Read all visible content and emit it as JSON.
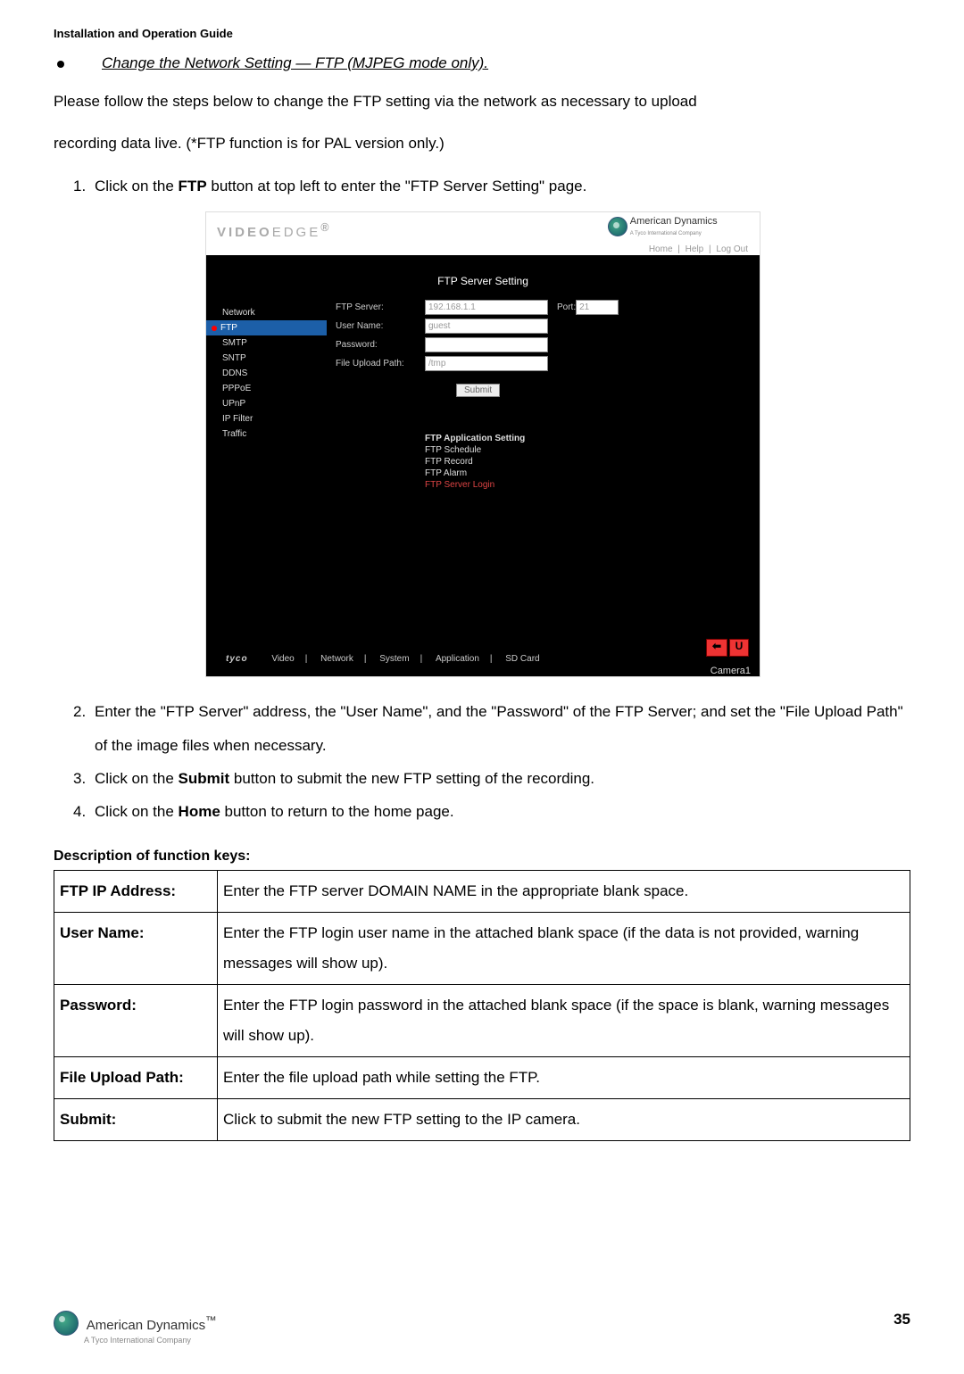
{
  "header": "Installation and Operation Guide",
  "bullet_title": "Change the Network Setting — FTP (MJPEG mode only).",
  "intro1": "Please follow the steps below to change the FTP setting via the network as necessary to upload",
  "intro2": "recording data live. (*FTP function is for PAL version only.)",
  "steps_top": {
    "1": {
      "pre": "1.",
      "a": "Click on the ",
      "b": "FTP",
      "c": " button at top left to enter the \"FTP Server Setting\" page."
    }
  },
  "screenshot": {
    "logo_a": "VIDEO",
    "logo_b": "EDGE",
    "brand": "American Dynamics",
    "brand_sub": "A Tyco International Company",
    "top_links": {
      "home": "Home",
      "help": "Help",
      "logout": "Log Out"
    },
    "panel_title": "FTP Server Setting",
    "menu": [
      "Network",
      "FTP",
      "SMTP",
      "SNTP",
      "DDNS",
      "PPPoE",
      "UPnP",
      "IP Filter",
      "Traffic"
    ],
    "menu_active_index": 1,
    "form": {
      "server_label": "FTP Server:",
      "server_value": "192.168.1.1",
      "port_label": "Port:",
      "port_value": "21",
      "user_label": "User Name:",
      "user_value": "guest",
      "pass_label": "Password:",
      "pass_value": "",
      "path_label": "File Upload Path:",
      "path_value": "/tmp",
      "submit": "Submit"
    },
    "app_links": {
      "title": "FTP Application Setting",
      "items": [
        "FTP Schedule",
        "FTP Record",
        "FTP Alarm",
        "FTP Server Login"
      ],
      "active_index": 3
    },
    "bottom": {
      "tyco": "tyco",
      "links": [
        "Video",
        "Network",
        "System",
        "Application",
        "SD Card"
      ],
      "back": "⬅",
      "u": "U",
      "camera": "Camera1"
    }
  },
  "steps_bottom": {
    "2": "Enter the \"FTP Server\" address, the \"User Name\", and the \"Password\" of the FTP Server; and set the \"File Upload Path\" of the image files when necessary.",
    "3": {
      "a": "Click on the ",
      "b": "Submit",
      "c": " button to submit the new FTP setting of the recording."
    },
    "4": {
      "a": "Click on the ",
      "b": "Home",
      "c": " button to return to the home page."
    }
  },
  "desc_title": "Description of function keys:",
  "table": {
    "rows": [
      {
        "k": "FTP IP Address:",
        "v": "Enter the FTP server DOMAIN NAME in the appropriate blank space."
      },
      {
        "k": "User Name:",
        "v": "Enter the FTP login user name in the attached blank space (if the data is not provided, warning messages will show up)."
      },
      {
        "k": "Password:",
        "v": "Enter the FTP login password in the attached blank space (if the space is blank, warning messages will show up)."
      },
      {
        "k": "File Upload Path:",
        "v": "Enter the file upload path while setting the FTP."
      },
      {
        "k": "Submit:",
        "v": "Click to submit the new FTP setting to the IP camera."
      }
    ]
  },
  "footer": {
    "brand": "American Dynamics",
    "tm": "™",
    "sub": "A Tyco International Company",
    "page": "35"
  }
}
